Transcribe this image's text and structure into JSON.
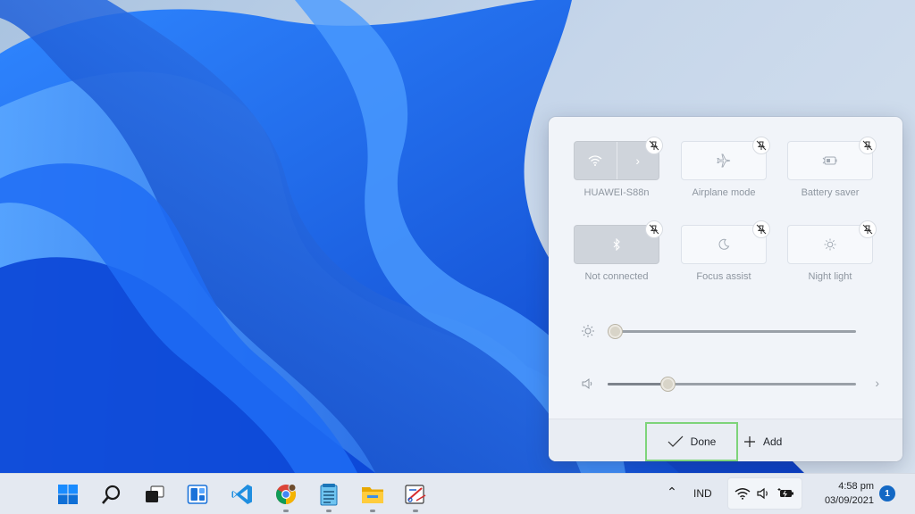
{
  "quick_settings": {
    "tiles": [
      {
        "label": "HUAWEI-S88n",
        "icon": "wifi-icon",
        "state": "on",
        "has_chevron": true
      },
      {
        "label": "Airplane mode",
        "icon": "airplane-icon",
        "state": "off"
      },
      {
        "label": "Battery saver",
        "icon": "battery-saver-icon",
        "state": "off"
      },
      {
        "label": "Not connected",
        "icon": "bluetooth-icon",
        "state": "on"
      },
      {
        "label": "Focus assist",
        "icon": "moon-icon",
        "state": "off"
      },
      {
        "label": "Night light",
        "icon": "sun-icon",
        "state": "off"
      }
    ],
    "brightness_level": 0.03,
    "volume_level": 0.24,
    "footer": {
      "done_label": "Done",
      "add_label": "Add"
    }
  },
  "taskbar": {
    "apps": [
      "windows-start-icon",
      "search-icon",
      "task-view-icon",
      "widgets-icon",
      "vscode-icon",
      "chrome-icon",
      "notepad-icon",
      "file-explorer-icon",
      "snipping-tool-icon"
    ],
    "language": "IND",
    "time": "4:58 pm",
    "date": "03/09/2021",
    "notification_count": "1"
  },
  "colors": {
    "accent": "#1368c4",
    "done_highlight": "#7ed47a",
    "wallpaper_blue": "#1a5ce8"
  }
}
